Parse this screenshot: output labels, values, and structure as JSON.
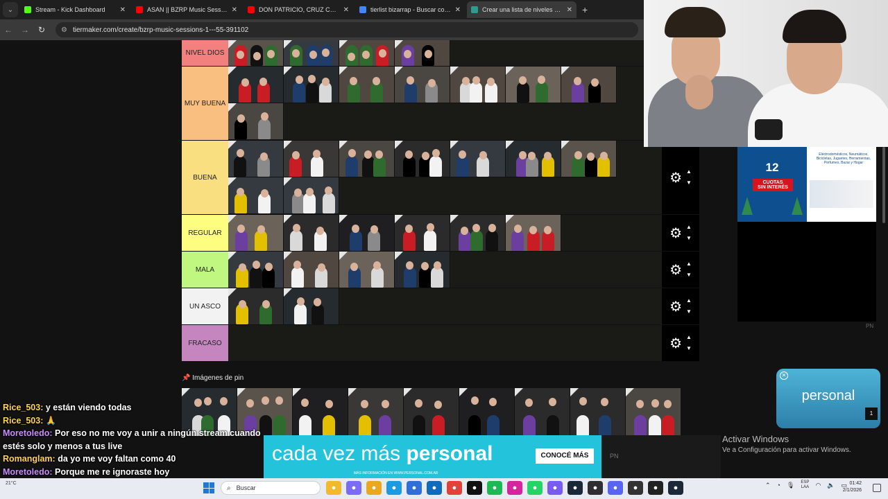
{
  "browser": {
    "tabs": [
      {
        "title": "Stream - Kick Dashboard",
        "favicon_color": "#53fc18",
        "active": false
      },
      {
        "title": "ASAN || BZRP Music Sessions #",
        "favicon_color": "#ff0000",
        "active": false
      },
      {
        "title": "DON PATRICIO, CRUZ CAFUNÉ",
        "favicon_color": "#ff0000",
        "active": false
      },
      {
        "title": "tierlist bizarrap - Buscar con Go",
        "favicon_color": "#4285f4",
        "active": false
      },
      {
        "title": "Crear una lista de niveles de SE",
        "favicon_color": "#2a9d8f",
        "active": true
      }
    ],
    "new_tab": "+",
    "address": "tiermaker.com/create/bzrp-music-sessions-1---55-391102",
    "icons": {
      "back": "arrow-left-icon",
      "forward": "arrow-right-icon",
      "reload": "reload-icon"
    }
  },
  "tiers": [
    {
      "label": "NIVEL DIOS",
      "color": "#f47f7f",
      "items": 4,
      "controls": false
    },
    {
      "label": "MUY BUENA",
      "color": "#f9bf80",
      "items": 8,
      "controls": false
    },
    {
      "label": "BUENA",
      "color": "#f9df80",
      "items": 9,
      "controls": true
    },
    {
      "label": "REGULAR",
      "color": "#fdfd80",
      "items": 6,
      "controls": true
    },
    {
      "label": "MALA",
      "color": "#bff780",
      "items": 4,
      "controls": true
    },
    {
      "label": "UN ASCO",
      "color": "#f2f2f2",
      "items": 2,
      "controls": true
    },
    {
      "label": "FRACASO",
      "color": "#c586c0",
      "items": 0,
      "controls": true
    }
  ],
  "pin": {
    "label": "Imágenes de pin",
    "items": 9
  },
  "ads": {
    "right": {
      "big": "12",
      "sub1": "CUOTAS",
      "sub2": "SIN INTERÉS",
      "detail": "Electrodomésticos, Neumáticos, Bicicletas, Juguetes, Herramientas, Perfumes, Bazar y Hogar"
    },
    "pn_small": "PN",
    "personal_popup": {
      "word": "personal",
      "badge": "1"
    },
    "banner": {
      "text_light": "cada vez más",
      "text_bold": "personal",
      "cta": "CONOCÉ MÁS",
      "small": "MÁS INFORMACIÓN EN WWW.PERSONAL.COM.AR"
    },
    "banner_pn": "PN"
  },
  "windows_activation": {
    "title": "Activar Windows",
    "subtitle": "Ve a Configuración para activar Windows."
  },
  "chat": [
    {
      "user": "Rice_503:",
      "color": "#ffd54a",
      "text": "y están viendo todas"
    },
    {
      "user": "Rice_503:",
      "color": "#ffd54a",
      "text": "🙏"
    },
    {
      "user": "Moretoledo:",
      "color": "#c98cff",
      "text": "Por eso no me voy a unir a ningún stream cuando estés solo y menos a tus live"
    },
    {
      "user": "Romanglam:",
      "color": "#ffd54a",
      "text": "da yo me voy faltan como 40"
    },
    {
      "user": "Moretoledo:",
      "color": "#c98cff",
      "text": "Porque me re ignoraste hoy"
    }
  ],
  "taskbar": {
    "weather": "21°C",
    "search_placeholder": "Buscar",
    "apps": [
      {
        "name": "explorer-icon",
        "color": "#f1b92c"
      },
      {
        "name": "copilot-icon",
        "color": "#7b6cf6"
      },
      {
        "name": "files-icon",
        "color": "#e9a820"
      },
      {
        "name": "edge-icon",
        "color": "#1e9be0"
      },
      {
        "name": "store-icon",
        "color": "#2f6fd8"
      },
      {
        "name": "outlook-icon",
        "color": "#0f6cbd"
      },
      {
        "name": "chrome-icon",
        "color": "#e3423a"
      },
      {
        "name": "tiktok-icon",
        "color": "#111111"
      },
      {
        "name": "spotify-icon",
        "color": "#1db954"
      },
      {
        "name": "instagram-icon",
        "color": "#d6249f"
      },
      {
        "name": "whatsapp-icon",
        "color": "#25d366"
      },
      {
        "name": "messenger-icon",
        "color": "#7a5cf0"
      },
      {
        "name": "steam-icon",
        "color": "#1b2838"
      },
      {
        "name": "obs-icon",
        "color": "#302e31"
      },
      {
        "name": "discord-icon",
        "color": "#5865f2"
      },
      {
        "name": "recorder-icon",
        "color": "#333333"
      },
      {
        "name": "chatgpt-icon",
        "color": "#222222"
      },
      {
        "name": "steam2-icon",
        "color": "#1b2838"
      }
    ],
    "lang_line1": "ESP",
    "lang_line2": "LAA",
    "time": "01:42",
    "date": "2/1/2026"
  }
}
